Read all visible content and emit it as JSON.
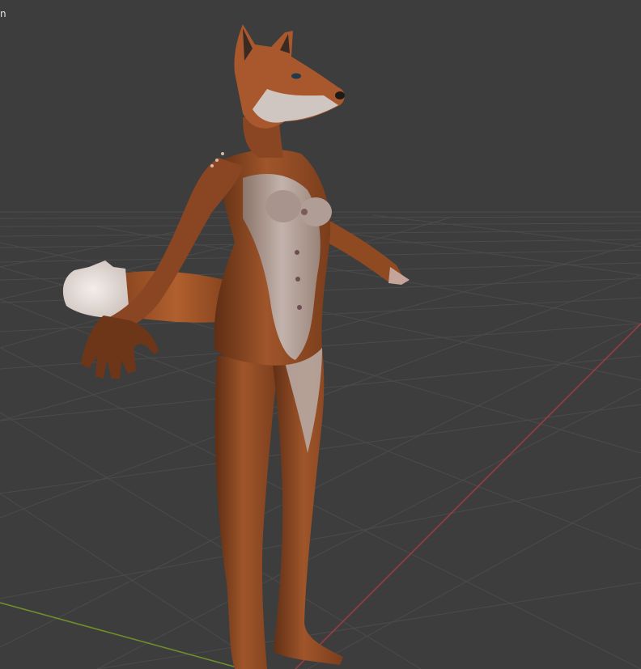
{
  "viewport": {
    "overlay_text": "n",
    "background_color": "#3d3d3d",
    "grid_color": "#4a4a4a",
    "x_axis_color": "#9b3b45",
    "y_axis_color": "#6e8f2a"
  },
  "model": {
    "description_icon": "fox-character-icon",
    "fur_color": "#a0552a",
    "dark_fur_color": "#6a3418",
    "belly_color": "#b8aaa4",
    "tail_tip_color": "#e9e2de"
  }
}
